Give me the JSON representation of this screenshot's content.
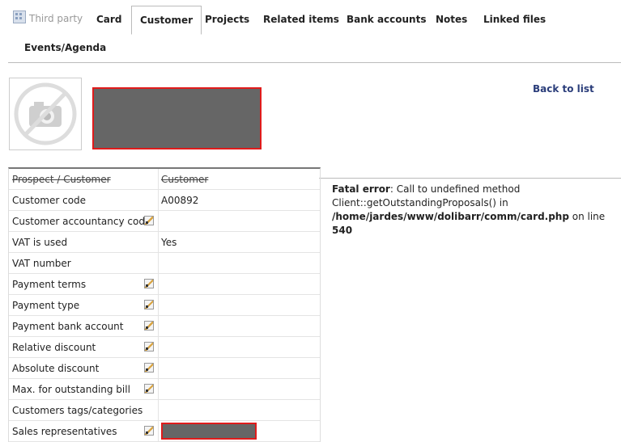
{
  "tabs": {
    "third_party": "Third party",
    "card": "Card",
    "customer": "Customer",
    "projects": "Projects",
    "related_items": "Related items",
    "bank_accounts": "Bank accounts",
    "notes": "Notes",
    "linked_files": "Linked files",
    "events_agenda": "Events/Agenda"
  },
  "header": {
    "back_to_list": "Back to list"
  },
  "fields": [
    {
      "label": "Prospect / Customer",
      "value": "Customer"
    },
    {
      "label": "Customer code",
      "value": "A00892"
    },
    {
      "label": "Customer accountancy code",
      "value": ""
    },
    {
      "label": "VAT is used",
      "value": "Yes"
    },
    {
      "label": "VAT number",
      "value": ""
    },
    {
      "label": "Payment terms",
      "value": ""
    },
    {
      "label": "Payment type",
      "value": ""
    },
    {
      "label": "Payment bank account",
      "value": ""
    },
    {
      "label": "Relative discount",
      "value": ""
    },
    {
      "label": "Absolute discount",
      "value": ""
    },
    {
      "label": "Max. for outstanding bill",
      "value": ""
    },
    {
      "label": "Customers tags/categories",
      "value": ""
    },
    {
      "label": "Sales representatives",
      "value": ""
    }
  ],
  "error": {
    "title": "Fatal error",
    "message": ": Call to undefined method Client::getOutstandingProposals() in",
    "path": "/home/jardes/www/dolibarr/comm/card.php",
    "on_line": " on line ",
    "line": "540"
  },
  "icons": {
    "third_party": "building-icon",
    "no_photo": "no-photo-camera-icon",
    "edit": "pencil-edit-icon"
  },
  "colors": {
    "redaction_fill": "#666666",
    "redaction_border": "#e01b1b",
    "link": "#2a3d7a"
  }
}
